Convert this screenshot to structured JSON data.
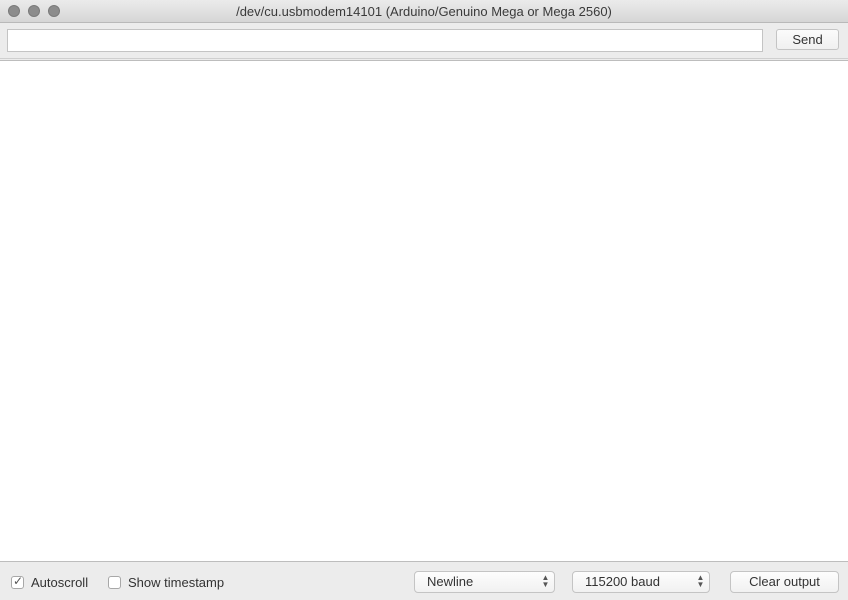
{
  "window": {
    "title": "/dev/cu.usbmodem14101 (Arduino/Genuino Mega or Mega 2560)"
  },
  "toolbar": {
    "input_value": "",
    "send_label": "Send"
  },
  "output": {
    "text": ""
  },
  "bottom": {
    "autoscroll_label": "Autoscroll",
    "autoscroll_checked": true,
    "timestamp_label": "Show timestamp",
    "timestamp_checked": false,
    "line_ending": "Newline",
    "baud_rate": "115200 baud",
    "clear_label": "Clear output"
  },
  "icons": {
    "close": "close-icon",
    "minimize": "minimize-icon",
    "maximize": "maximize-icon",
    "checkmark": "checkmark-icon",
    "updown": "updown-chevron-icon"
  }
}
